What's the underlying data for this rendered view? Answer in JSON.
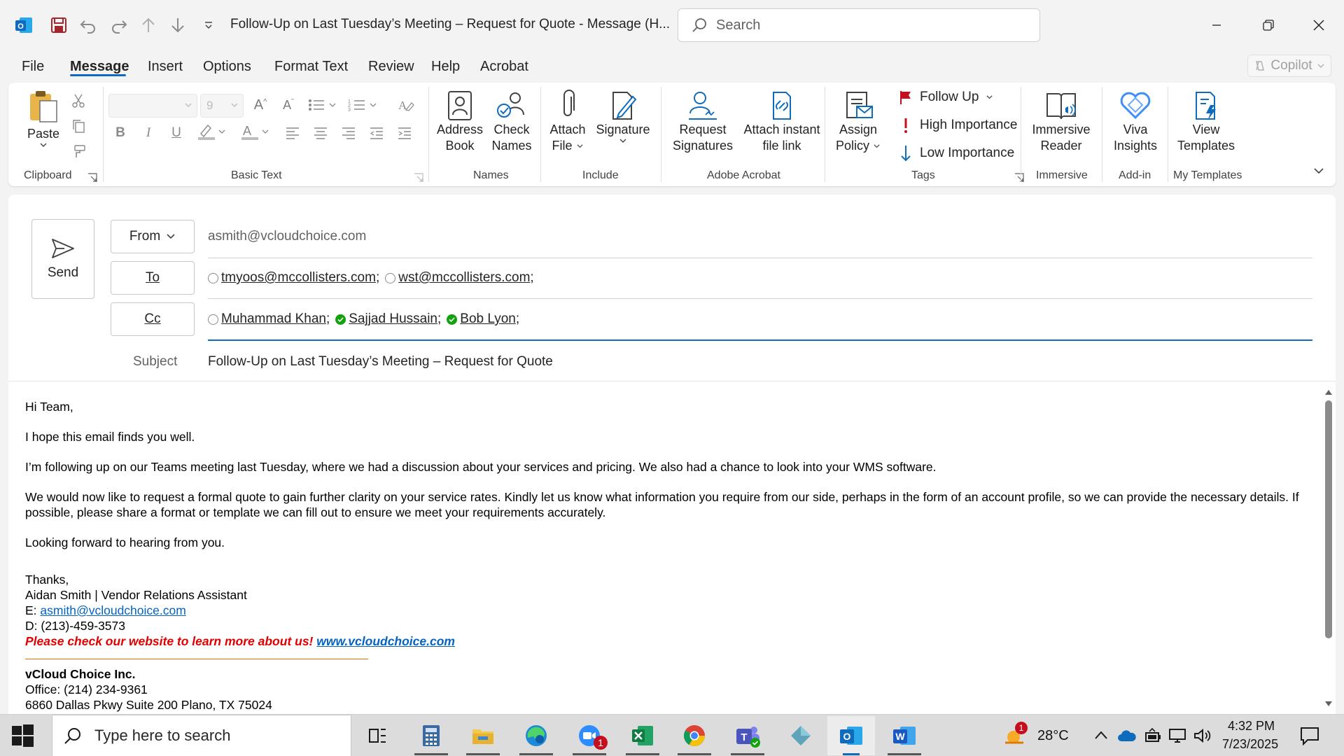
{
  "window": {
    "title": "Follow-Up on Last Tuesday’s Meeting – Request for Quote  -  Message (H...",
    "search_placeholder": "Search"
  },
  "menu": {
    "tabs": [
      "File",
      "Message",
      "Insert",
      "Options",
      "Format Text",
      "Review",
      "Help",
      "Acrobat"
    ],
    "active": "Message",
    "copilot_label": "Copilot"
  },
  "ribbon": {
    "clipboard": {
      "paste": "Paste",
      "group": "Clipboard"
    },
    "basic_text": {
      "font_size": "9",
      "group": "Basic Text"
    },
    "names": {
      "address_book_1": "Address",
      "address_book_2": "Book",
      "check_names_1": "Check",
      "check_names_2": "Names",
      "group": "Names"
    },
    "include": {
      "attach_1": "Attach",
      "attach_2": "File",
      "signature": "Signature",
      "group": "Include"
    },
    "acrobat": {
      "request_1": "Request",
      "request_2": "Signatures",
      "attach_link_1": "Attach instant",
      "attach_link_2": "file link",
      "group": "Adobe Acrobat"
    },
    "tags": {
      "assign_1": "Assign",
      "assign_2": "Policy",
      "follow_up": "Follow Up",
      "high": "High Importance",
      "low": "Low Importance",
      "group": "Tags"
    },
    "immersive": {
      "label_1": "Immersive",
      "label_2": "Reader",
      "group": "Immersive"
    },
    "addin": {
      "label_1": "Viva",
      "label_2": "Insights",
      "group": "Add-in"
    },
    "templates": {
      "label_1": "View",
      "label_2": "Templates",
      "group": "My Templates"
    }
  },
  "compose": {
    "send_label": "Send",
    "from_label": "From",
    "from_value": "asmith@vcloudchoice.com",
    "to_label": "To",
    "to": [
      "tmyoos@mccollisters.com",
      "wst@mccollisters.com"
    ],
    "cc_label": "Cc",
    "cc": [
      "Muhammad Khan",
      "Sajjad Hussain",
      "Bob Lyon"
    ],
    "subject_label": "Subject",
    "subject": "Follow-Up on Last Tuesday’s Meeting – Request for Quote"
  },
  "body": {
    "greeting": "Hi Team,",
    "p1": "I hope this email finds you well.",
    "p2": "I’m following up on our Teams meeting last Tuesday, where we had a discussion about your services and pricing. We also had a chance to look into your WMS software.",
    "p3": "We would now like to request a formal quote to gain further clarity on your service rates. Kindly let us know what information you require from our side, perhaps in the form of an account profile, so we can provide the necessary details. If possible, please share a format or template we can fill out to ensure we meet your requirements accurately.",
    "p4": "Looking forward to hearing from you.",
    "thanks": "Thanks,",
    "sig_name": "Aidan Smith | Vendor Relations Assistant",
    "email_prefix": "E: ",
    "email": "asmith@vcloudchoice.com",
    "direct": "D: (213)-459-3573",
    "promo": "Please check our website to learn more about us! ",
    "website": "www.vcloudchoice.com",
    "company": "vCloud Choice Inc.",
    "office": "Office: (214) 234-9361",
    "address": "6860 Dallas Pkwy Suite 200 Plano, TX 75024"
  },
  "taskbar": {
    "search_placeholder": "Type here to search",
    "weather": "28°C",
    "weather_badge": "1",
    "zoom_badge": "1",
    "time": "4:32 PM",
    "date": "7/23/2025"
  },
  "colors": {
    "accent": "#0f6cbd",
    "promo_red": "#e00000",
    "link_blue": "#0563c1",
    "rule_orange": "#e36c09"
  }
}
